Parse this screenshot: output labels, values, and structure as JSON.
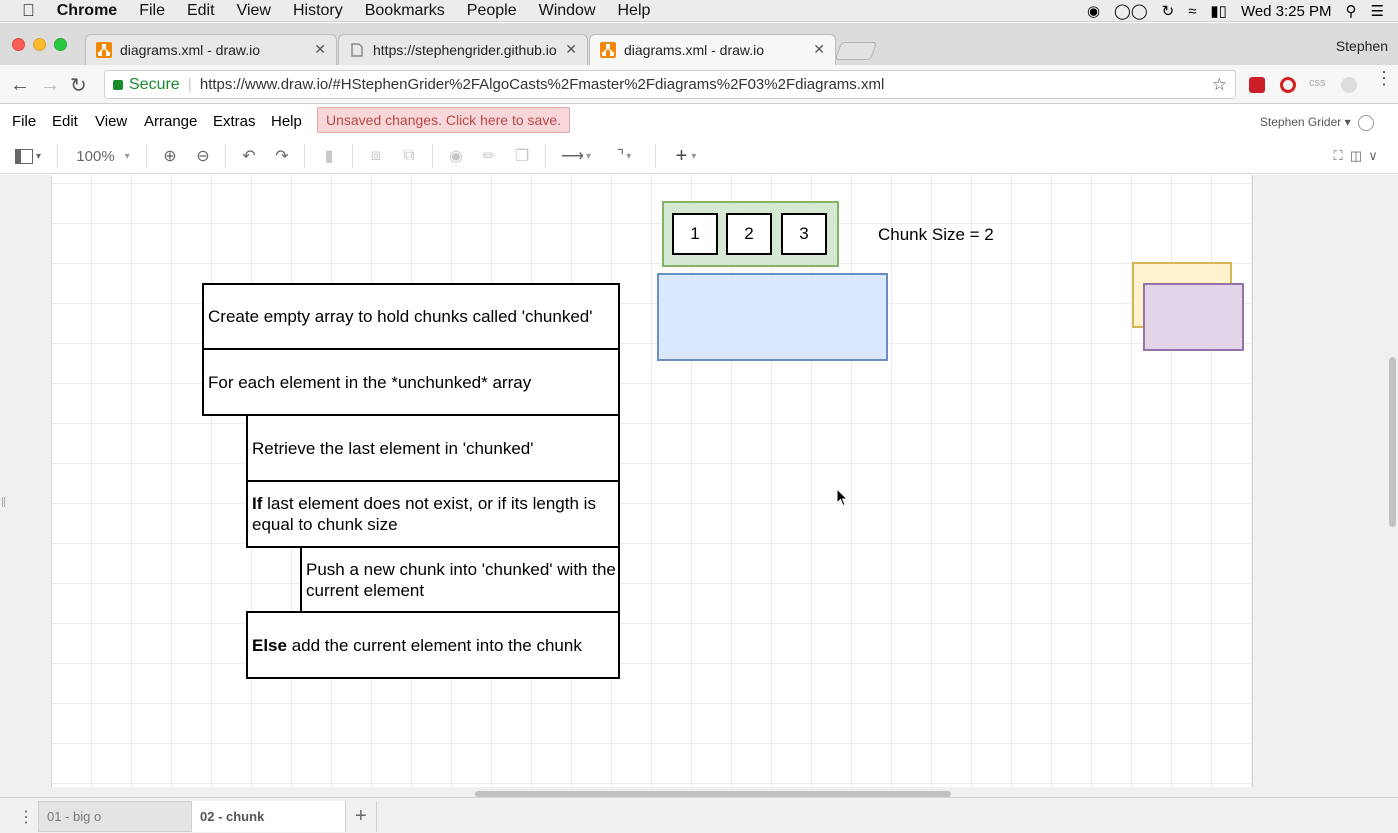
{
  "os_menubar": {
    "app": "Chrome",
    "items": [
      "File",
      "Edit",
      "View",
      "History",
      "Bookmarks",
      "People",
      "Window",
      "Help"
    ],
    "clock": "Wed 3:25 PM"
  },
  "browser": {
    "tabs": [
      {
        "title": "diagrams.xml - draw.io"
      },
      {
        "title": "https://stephengrider.github.io"
      },
      {
        "title": "diagrams.xml - draw.io"
      }
    ],
    "profile": "Stephen",
    "secure_label": "Secure",
    "url": "https://www.draw.io/#HStephenGrider%2FAlgoCasts%2Fmaster%2Fdiagrams%2F03%2Fdiagrams.xml",
    "ext_css": "css"
  },
  "drawio": {
    "menu": [
      "File",
      "Edit",
      "View",
      "Arrange",
      "Extras",
      "Help"
    ],
    "unsaved": "Unsaved changes. Click here to save.",
    "user": "Stephen Grider",
    "zoom": "100%"
  },
  "diagram": {
    "array_items": [
      "1",
      "2",
      "3"
    ],
    "chunk_size_label": "Chunk Size = 2",
    "steps": {
      "s1": "Create empty array to hold chunks called 'chunked'",
      "s2": "For each element in the *unchunked* array",
      "s3": "Retrieve the last element in 'chunked'",
      "s4_bold": "If",
      "s4_rest": " last element does not exist, or if its length is equal to chunk size",
      "s5": "Push a new chunk into 'chunked' with the current element",
      "s6_bold": "Else",
      "s6_rest": " add the current element into the chunk"
    },
    "colors": {
      "green_fill": "#d5e8d4",
      "green_stroke": "#82b366",
      "blue_fill": "#dae8fc",
      "blue_stroke": "#6c8ebf",
      "yellow_fill": "#fff2cc",
      "yellow_stroke": "#d6b656",
      "purple_fill": "#e1d5e7",
      "purple_stroke": "#9673a6"
    }
  },
  "pages": [
    {
      "label": "01 - big o"
    },
    {
      "label": "02 - chunk"
    }
  ]
}
